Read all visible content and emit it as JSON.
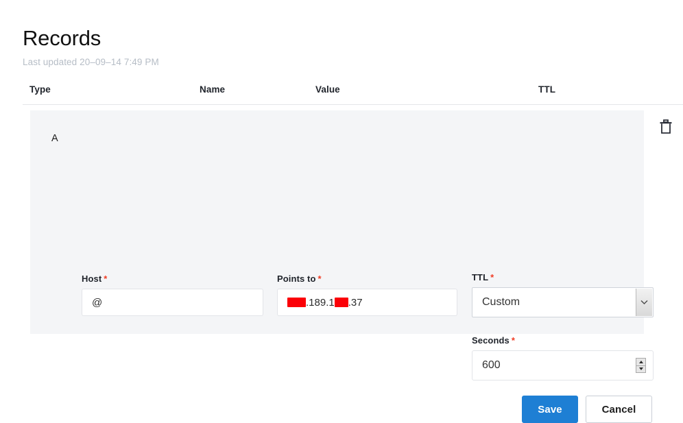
{
  "page": {
    "title": "Records",
    "last_updated": "Last updated 20–09–14 7:49 PM"
  },
  "table": {
    "columns": [
      {
        "key": "type",
        "label": "Type"
      },
      {
        "key": "name",
        "label": "Name"
      },
      {
        "key": "value",
        "label": "Value"
      },
      {
        "key": "ttl",
        "label": "TTL"
      }
    ]
  },
  "record": {
    "type": "A",
    "required_marker": "*",
    "host": {
      "label": "Host",
      "value": "@",
      "placeholder": "@",
      "required": true
    },
    "points_to": {
      "label": "Points to",
      "value_visible": ".189.1  .37",
      "value_prefix_redacted": true,
      "value_segments": [
        {
          "type": "redacted",
          "width": 27
        },
        {
          "type": "text",
          "text": ".189.1"
        },
        {
          "type": "redacted",
          "width": 20
        },
        {
          "type": "text",
          "text": ".37"
        }
      ],
      "required": true
    },
    "ttl": {
      "label": "TTL",
      "selected": "Custom",
      "options": [
        "Custom"
      ],
      "required": true
    },
    "seconds": {
      "label": "Seconds",
      "value": "600",
      "required": true
    },
    "actions": {
      "save_label": "Save",
      "cancel_label": "Cancel",
      "delete_icon": "trash-icon"
    }
  },
  "colors": {
    "accent": "#1e7fd4",
    "required": "#f03d25",
    "redaction": "#fb0007",
    "panel_bg": "#f4f5f7",
    "muted_text": "#b6bdc6"
  }
}
